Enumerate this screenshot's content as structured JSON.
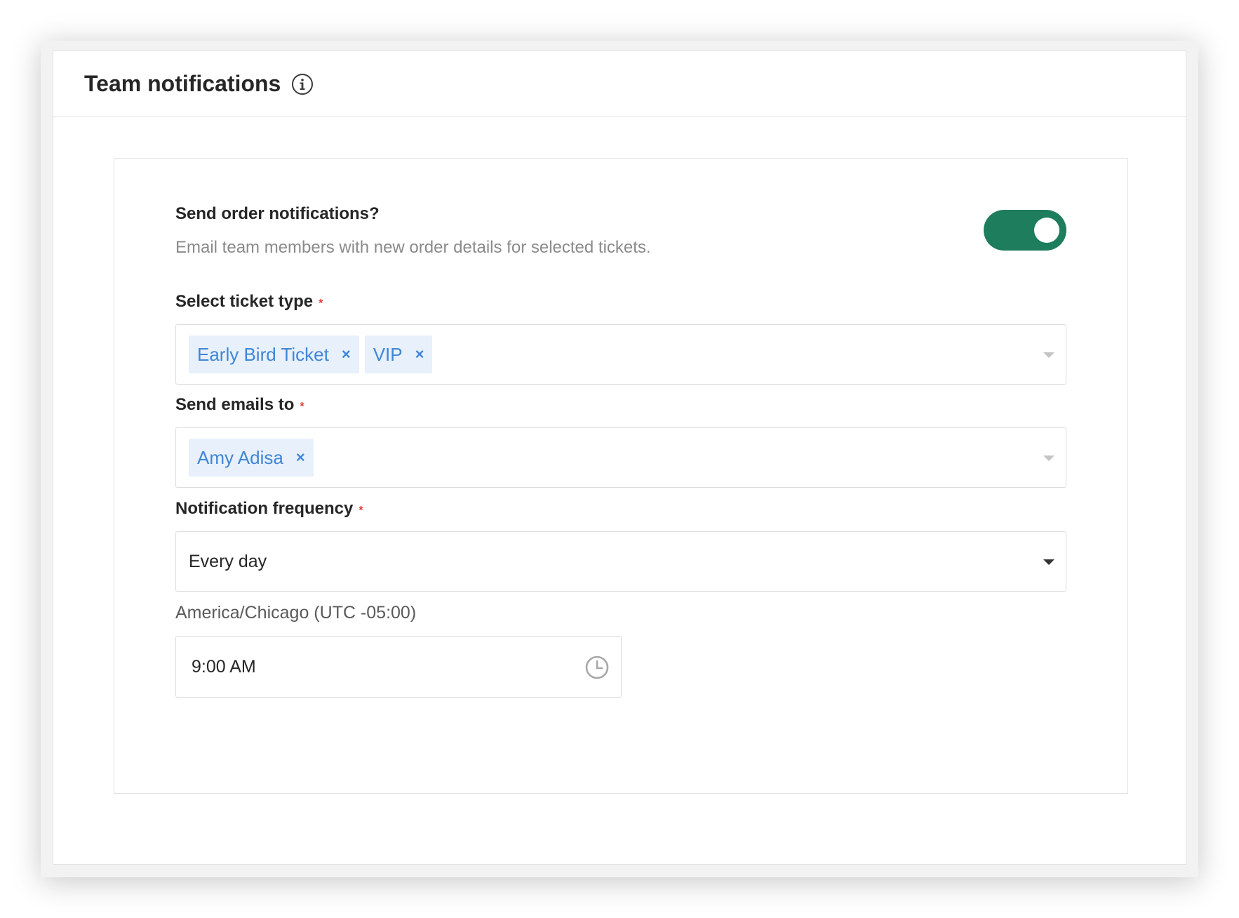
{
  "header": {
    "title": "Team notifications",
    "info_icon": "info-circle-icon"
  },
  "order_notifications": {
    "label": "Send order notifications?",
    "description": "Email team members with new order details for selected tickets.",
    "enabled": true
  },
  "ticket_type": {
    "label": "Select ticket type",
    "required_mark": "*",
    "selected": [
      "Early Bird Ticket",
      "VIP"
    ]
  },
  "send_emails": {
    "label": "Send emails to",
    "required_mark": "*",
    "selected": [
      "Amy Adisa"
    ]
  },
  "frequency": {
    "label": "Notification frequency",
    "required_mark": "*",
    "value": "Every day"
  },
  "time": {
    "timezone_label": "America/Chicago (UTC -05:00)",
    "value": "9:00 AM",
    "icon": "clock-icon"
  },
  "colors": {
    "toggle_on": "#1e7d5c",
    "chip_bg": "#e7f0fb",
    "chip_text": "#3f86d6",
    "required": "#e53935"
  },
  "chip_remove_glyph": "×"
}
